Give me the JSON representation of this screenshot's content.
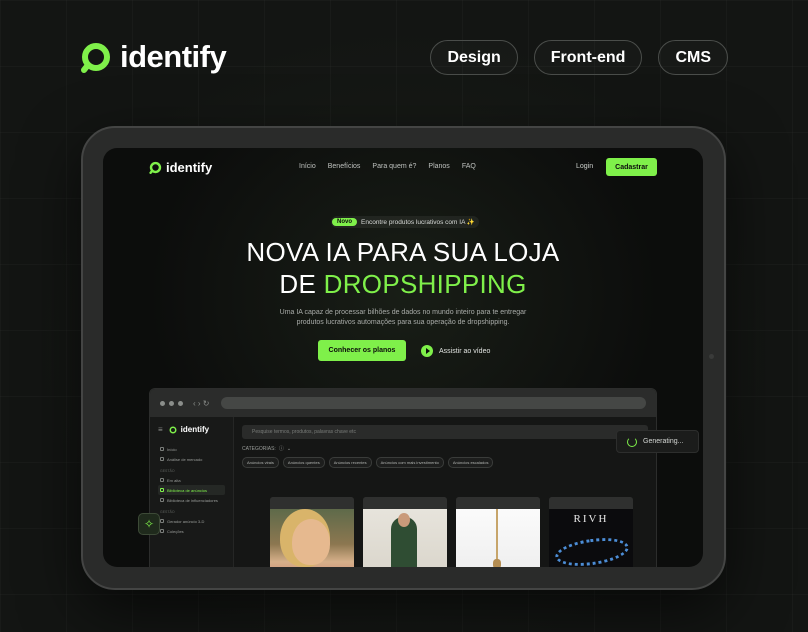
{
  "header": {
    "brand_name": "identify",
    "tags": [
      "Design",
      "Front-end",
      "CMS"
    ]
  },
  "site": {
    "brand_name": "identify",
    "nav": [
      "Início",
      "Benefícios",
      "Para quem é?",
      "Planos",
      "FAQ"
    ],
    "login_label": "Login",
    "signup_label": "Cadastrar",
    "badge_new": "Novo",
    "badge_text": "Encontre produtos lucrativos com IA ✨",
    "title_line1": "NOVA IA PARA SUA LOJA",
    "title_line2_prefix": "DE",
    "title_line2_accent": "DROPSHIPPING",
    "description": "Uma IA capaz de processar bilhões de dados no mundo inteiro para te entregar produtos lucrativos automações para sua operação de dropshipping.",
    "cta_label": "Conhecer os planos",
    "watch_label": "Assistir ao vídeo"
  },
  "app": {
    "brand_name": "identify",
    "sidebar": {
      "items_top": [
        "Início",
        "Análise de mercado"
      ],
      "section1": "GESTÃO",
      "items_mid": [
        "Em alta",
        "Biblioteca de anúncios",
        "Biblioteca de influenciadores"
      ],
      "section2": "GESTÃO",
      "items_bot": [
        "Gerador anúncio 3-D",
        "Coleções"
      ]
    },
    "search_placeholder": "Pesquise termos, produtos, palavras chave etc",
    "categories_label": "CATEGORIAS:",
    "chips": [
      "Anúncios virais",
      "Anúncios quentes",
      "Anúncios recentes",
      "Anúncios com mais investimento",
      "Anúncios escalados"
    ],
    "card_brand_text": "RIVH",
    "generating_label": "Generating..."
  },
  "colors": {
    "accent": "#7ff04a",
    "background": "#131513"
  }
}
